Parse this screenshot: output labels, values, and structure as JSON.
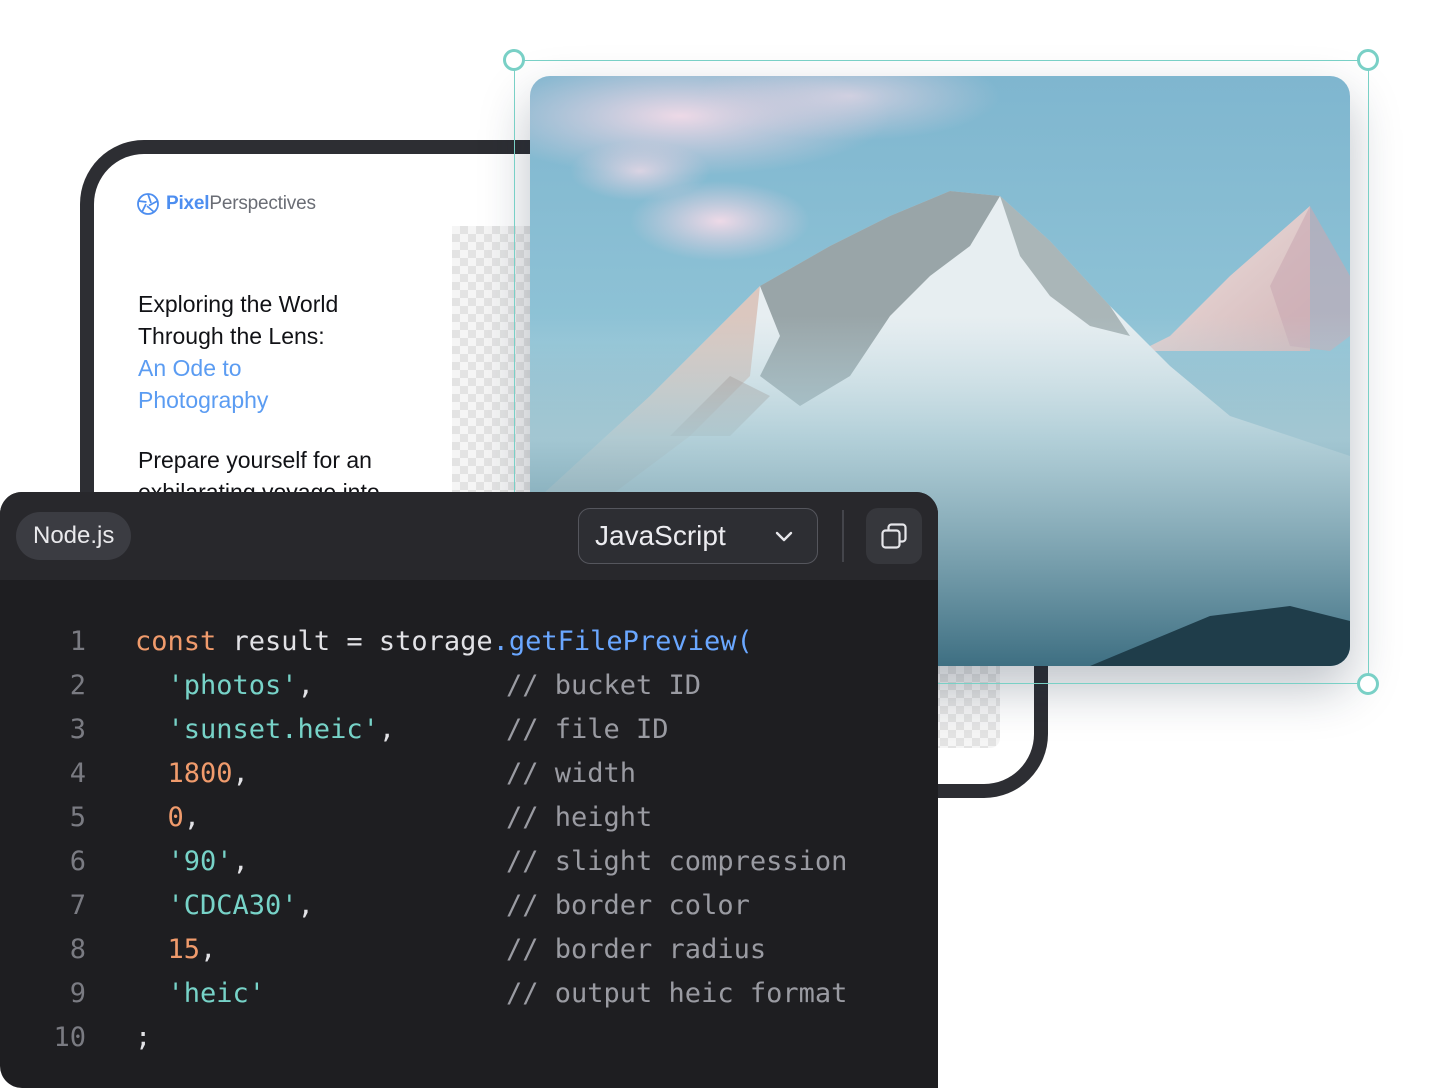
{
  "article": {
    "brand_bold": "Pixel",
    "brand_light": "Perspectives",
    "title_lines": [
      "Exploring the World",
      "Through the Lens:"
    ],
    "title_accent_lines": [
      "An Ode to",
      "Photography"
    ],
    "body_lines": [
      "Prepare yourself for an",
      "exhilarating voyage into"
    ]
  },
  "photo": {
    "subject": "snow-capped mountain peak above clouds"
  },
  "code_panel": {
    "runtime_label": "Node.js",
    "language_select": "JavaScript",
    "copy_icon": "copy-icon",
    "lines": [
      {
        "num": "1",
        "parts": [
          [
            "kw",
            "const"
          ],
          [
            "plain",
            " result = storage"
          ],
          [
            "fn",
            ".getFilePreview("
          ]
        ],
        "comment": ""
      },
      {
        "num": "2",
        "parts": [
          [
            "str",
            "  'photos'"
          ],
          [
            "plain",
            ","
          ]
        ],
        "comment": "// bucket ID"
      },
      {
        "num": "3",
        "parts": [
          [
            "str",
            "  'sunset.heic'"
          ],
          [
            "plain",
            ","
          ]
        ],
        "comment": "// file ID"
      },
      {
        "num": "4",
        "parts": [
          [
            "num",
            "  1800"
          ],
          [
            "plain",
            ","
          ]
        ],
        "comment": "// width"
      },
      {
        "num": "5",
        "parts": [
          [
            "num",
            "  0"
          ],
          [
            "plain",
            ","
          ]
        ],
        "comment": "// height"
      },
      {
        "num": "6",
        "parts": [
          [
            "str",
            "  '90'"
          ],
          [
            "plain",
            ","
          ]
        ],
        "comment": "// slight compression"
      },
      {
        "num": "7",
        "parts": [
          [
            "str",
            "  'CDCA30'"
          ],
          [
            "plain",
            ","
          ]
        ],
        "comment": "// border color"
      },
      {
        "num": "8",
        "parts": [
          [
            "num",
            "  15"
          ],
          [
            "plain",
            ","
          ]
        ],
        "comment": "// border radius"
      },
      {
        "num": "9",
        "parts": [
          [
            "str",
            "  'heic'"
          ]
        ],
        "comment": "// output heic format"
      },
      {
        "num": "10",
        "parts": [
          [
            "plain",
            ";"
          ]
        ],
        "comment": ""
      }
    ]
  },
  "colors": {
    "accent_blue": "#5b9cf2",
    "selection_teal": "#79d0c6",
    "code_bg": "#1e1e21",
    "keyword_orange": "#f09b6c",
    "string_teal": "#77d3c8",
    "function_blue": "#6aa7ff"
  }
}
